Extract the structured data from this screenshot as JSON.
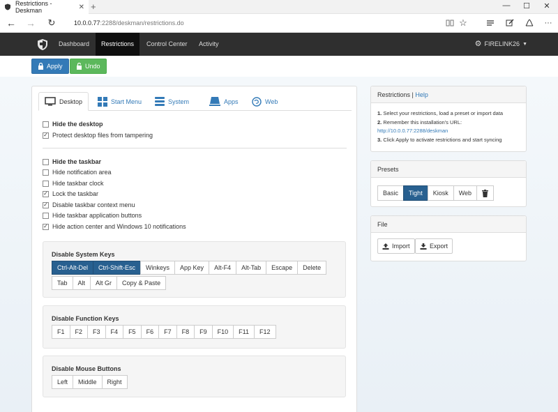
{
  "browser": {
    "tab_title": "Restrictions - Deskman",
    "url_host": "10.0.0.77",
    "url_rest": ":2288/deskman/restrictions.do"
  },
  "navbar": {
    "links": [
      "Dashboard",
      "Restrictions",
      "Control Center",
      "Activity"
    ],
    "active": "Restrictions",
    "user": "FIRELINK26"
  },
  "actions": {
    "apply": "Apply",
    "undo": "Undo"
  },
  "tabs": [
    "Desktop",
    "Start Menu",
    "System",
    "Apps",
    "Web"
  ],
  "desktop": {
    "group1": [
      {
        "label": "Hide the desktop",
        "checked": false,
        "bold": true
      },
      {
        "label": "Protect desktop files from tampering",
        "checked": true,
        "bold": false
      }
    ],
    "group2": [
      {
        "label": "Hide the taskbar",
        "checked": false,
        "bold": true
      },
      {
        "label": "Hide notification area",
        "checked": false,
        "bold": false
      },
      {
        "label": "Hide taskbar clock",
        "checked": false,
        "bold": false
      },
      {
        "label": "Lock the taskbar",
        "checked": true,
        "bold": false
      },
      {
        "label": "Disable taskbar context menu",
        "checked": true,
        "bold": false
      },
      {
        "label": "Hide taskbar application buttons",
        "checked": false,
        "bold": false
      },
      {
        "label": "Hide action center and Windows 10 notifications",
        "checked": true,
        "bold": false
      }
    ]
  },
  "system_keys": {
    "title": "Disable System Keys",
    "row1": [
      "Ctrl-Alt-Del",
      "Ctrl-Shift-Esc",
      "Winkeys",
      "App Key",
      "Alt-F4",
      "Alt-Tab",
      "Escape",
      "Delete"
    ],
    "row2": [
      "Tab",
      "Alt",
      "Alt Gr",
      "Copy & Paste"
    ],
    "active": [
      "Ctrl-Alt-Del",
      "Ctrl-Shift-Esc"
    ]
  },
  "function_keys": {
    "title": "Disable Function Keys",
    "keys": [
      "F1",
      "F2",
      "F3",
      "F4",
      "F5",
      "F6",
      "F7",
      "F8",
      "F9",
      "F10",
      "F11",
      "F12"
    ]
  },
  "mouse_buttons": {
    "title": "Disable Mouse Buttons",
    "buttons": [
      "Left",
      "Middle",
      "Right"
    ]
  },
  "sidebar": {
    "restrictions": {
      "title": "Restrictions",
      "sep": "|",
      "help": "Help",
      "step1_num": "1.",
      "step1": "Select your restrictions, load a preset or import data",
      "step2_num": "2.",
      "step2": "Remember this installation's URL:",
      "url": "http://10.0.0.77:2288/deskman",
      "step3_num": "3.",
      "step3": "Click Apply to activate restrictions and start syncing"
    },
    "presets": {
      "title": "Presets",
      "items": [
        "Basic",
        "Tight",
        "Kiosk",
        "Web"
      ],
      "active": "Tight"
    },
    "file": {
      "title": "File",
      "import": "Import",
      "export": "Export"
    }
  },
  "colors": {
    "accent": "#337ab7",
    "navbar": "#2f2f2f",
    "success": "#5cb85c",
    "active_key": "#286090"
  }
}
